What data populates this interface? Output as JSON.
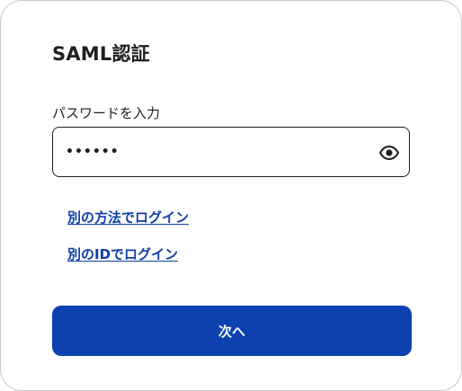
{
  "dialog": {
    "title": "SAML認証",
    "password_label": "パスワードを入力",
    "password_value": "••••••",
    "show_password_icon": "eye-icon",
    "links": {
      "other_method": "別の方法でログイン",
      "other_id": "別のIDでログイン"
    },
    "next_label": "次へ"
  },
  "colors": {
    "primary": "#0d41b0",
    "link": "#0d3fa8",
    "text": "#1f1f1f",
    "border": "#c9c9c9"
  }
}
